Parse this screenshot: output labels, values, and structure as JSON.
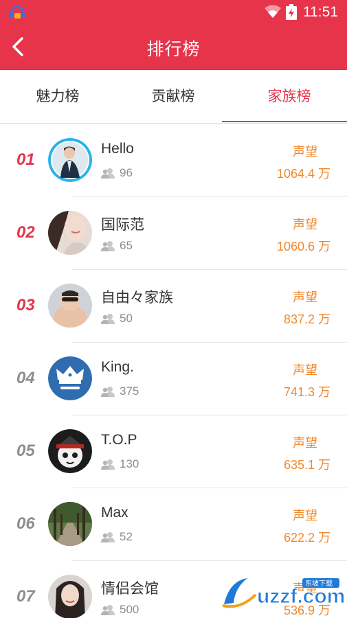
{
  "status_bar": {
    "time": "11:51"
  },
  "header": {
    "title": "排行榜"
  },
  "tabs": [
    {
      "label": "魅力榜"
    },
    {
      "label": "贡献榜"
    },
    {
      "label": "家族榜"
    }
  ],
  "active_tab": "家族榜",
  "rows": [
    {
      "rank": "01",
      "name": "Hello",
      "members": "96",
      "fame_label": "声望",
      "fame_value": "1064.4 万"
    },
    {
      "rank": "02",
      "name": "国际范",
      "members": "65",
      "fame_label": "声望",
      "fame_value": "1060.6 万"
    },
    {
      "rank": "03",
      "name": "自由々家族",
      "members": "50",
      "fame_label": "声望",
      "fame_value": "837.2 万"
    },
    {
      "rank": "04",
      "name": "King.",
      "members": "375",
      "fame_label": "声望",
      "fame_value": "741.3 万"
    },
    {
      "rank": "05",
      "name": "T.O.P",
      "members": "130",
      "fame_label": "声望",
      "fame_value": "635.1 万"
    },
    {
      "rank": "06",
      "name": "Max",
      "members": "52",
      "fame_label": "声望",
      "fame_value": "622.2 万"
    },
    {
      "rank": "07",
      "name": "情侣会馆",
      "members": "500",
      "fame_label": "声望",
      "fame_value": "536.9 万"
    }
  ],
  "watermark": {
    "brand": "uzzf.com",
    "tagline": "东坡下载"
  },
  "colors": {
    "primary": "#e6344b",
    "fame": "#f0892e",
    "rank_top": "#e6344b",
    "rank_other": "#8e8e8e"
  }
}
